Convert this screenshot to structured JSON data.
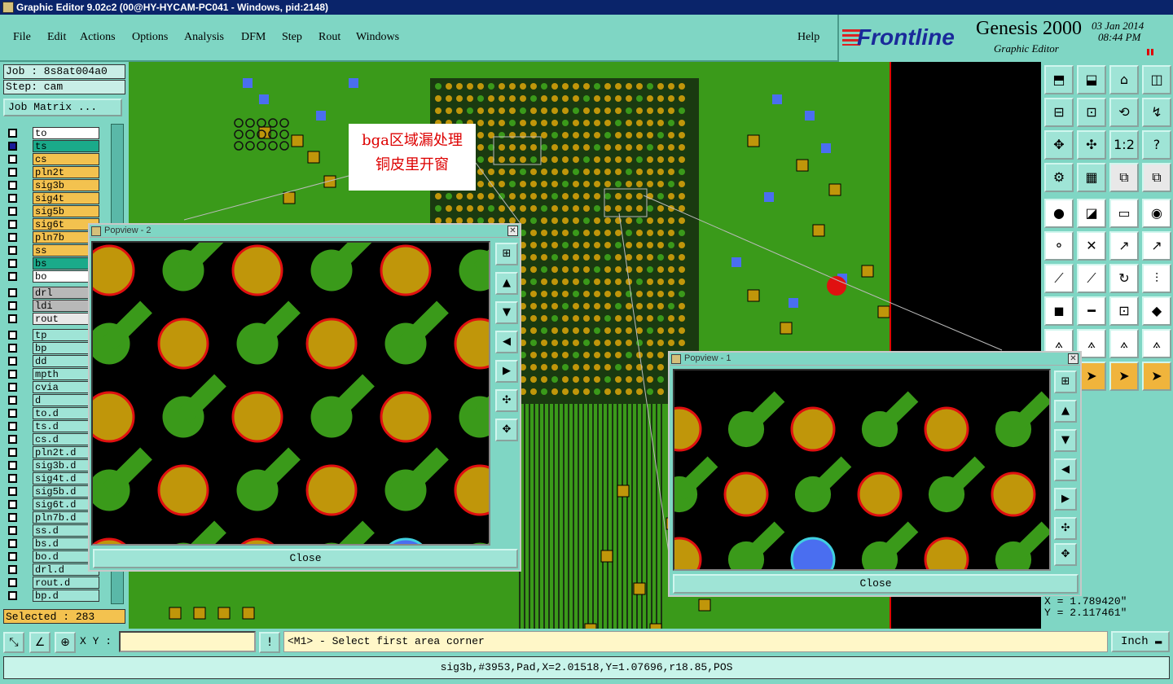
{
  "window": {
    "title": "Graphic Editor 9.02c2 (00@HY-HYCAM-PC041 - Windows, pid:2148)"
  },
  "menu": {
    "items": [
      "File",
      "Edit",
      "Actions",
      "Options",
      "Analysis",
      "DFM",
      "Step",
      "Rout",
      "Windows"
    ],
    "help": "Help"
  },
  "brand": {
    "logo": "Frontline",
    "product": "Genesis 2000",
    "subtitle": "Graphic Editor",
    "date": "03 Jan 2014",
    "time": "08:44 PM"
  },
  "job": {
    "job_label": "Job : 8s8at004a0",
    "step_label": "Step: cam",
    "matrix_button": "Job Matrix ..."
  },
  "layers": {
    "group1": [
      "to",
      "ts",
      "cs",
      "pln2t",
      "sig3b",
      "sig4t",
      "sig5b",
      "sig6t",
      "pln7b",
      "ss",
      "bs",
      "bo"
    ],
    "group2": [
      "drl",
      "ldi",
      "rout"
    ],
    "group3": [
      "tp",
      "bp",
      "dd",
      "mpth",
      "cvia",
      "d",
      "to.d",
      "ts.d",
      "cs.d",
      "pln2t.d",
      "sig3b.d",
      "sig4t.d",
      "sig5b.d",
      "sig6t.d",
      "pln7b.d",
      "ss.d",
      "bs.d",
      "bo.d",
      "drl.d",
      "rout.d",
      "bp.d"
    ]
  },
  "selected": "Selected : 283",
  "annotation": {
    "line1": "bga区域漏处理",
    "line2": "铜皮里开窗"
  },
  "popview2": {
    "title": "Popview - 2",
    "close": "Close"
  },
  "popview1": {
    "title": "Popview - 1",
    "close": "Close"
  },
  "coords": {
    "x": "X = 1.789420\"",
    "y": "Y = 2.117461\""
  },
  "cmd": {
    "xy_label": "X Y :",
    "xy_value": "",
    "prompt": "<M1> - Select first area corner",
    "unit": "Inch"
  },
  "status": "sig3b,#3953,Pad,X=2.01518,Y=1.07696,r18.85,POS",
  "toolbar": {
    "ratio_label": "1:2",
    "help_label": "?"
  },
  "colors": {
    "copper": "#3a9a1a",
    "pad": "#c0960a",
    "pad_outline": "#e01010",
    "via": "#4a6ef0",
    "background": "#000000",
    "panel": "#7fd6c4"
  }
}
